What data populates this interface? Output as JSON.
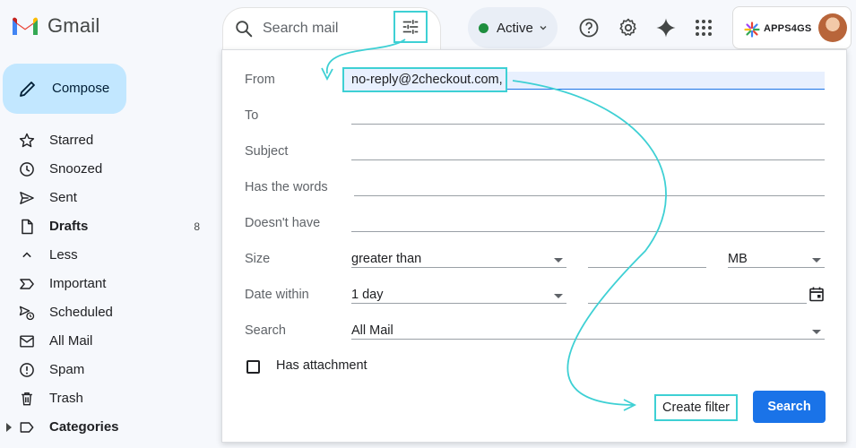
{
  "app": {
    "name": "Gmail",
    "search_placeholder": "Search mail"
  },
  "header": {
    "status_label": "Active",
    "status_color": "#1e8e3e",
    "icons": [
      "help-icon",
      "settings-icon",
      "gemini-spark-icon",
      "apps-grid-icon"
    ],
    "account_name": "APPS4GS"
  },
  "sidebar": {
    "compose_label": "Compose",
    "items": [
      {
        "label": "Starred",
        "icon": "star-icon"
      },
      {
        "label": "Snoozed",
        "icon": "clock-icon"
      },
      {
        "label": "Sent",
        "icon": "send-icon"
      },
      {
        "label": "Drafts",
        "icon": "draft-icon",
        "count": "8",
        "bold": true
      },
      {
        "label": "Less",
        "icon": "chevron-up-icon"
      },
      {
        "label": "Important",
        "icon": "important-icon"
      },
      {
        "label": "Scheduled",
        "icon": "scheduled-icon"
      },
      {
        "label": "All Mail",
        "icon": "all-mail-icon"
      },
      {
        "label": "Spam",
        "icon": "spam-icon"
      },
      {
        "label": "Trash",
        "icon": "trash-icon"
      },
      {
        "label": "Categories",
        "icon": "label-icon",
        "bold": true
      }
    ]
  },
  "filter": {
    "from_label": "From",
    "from_value": "no-reply@2checkout.com,",
    "to_label": "To",
    "subject_label": "Subject",
    "has_words_label": "Has the words",
    "doesnt_have_label": "Doesn't have",
    "size_label": "Size",
    "size_operator": "greater than",
    "size_unit": "MB",
    "date_within_label": "Date within",
    "date_within_value": "1 day",
    "search_label": "Search",
    "search_scope": "All Mail",
    "has_attachment_label": "Has attachment",
    "create_filter_label": "Create filter",
    "search_button_label": "Search"
  },
  "colors": {
    "highlight": "#3ed0d4",
    "primary": "#1a73e8",
    "compose_bg": "#c2e7ff"
  }
}
